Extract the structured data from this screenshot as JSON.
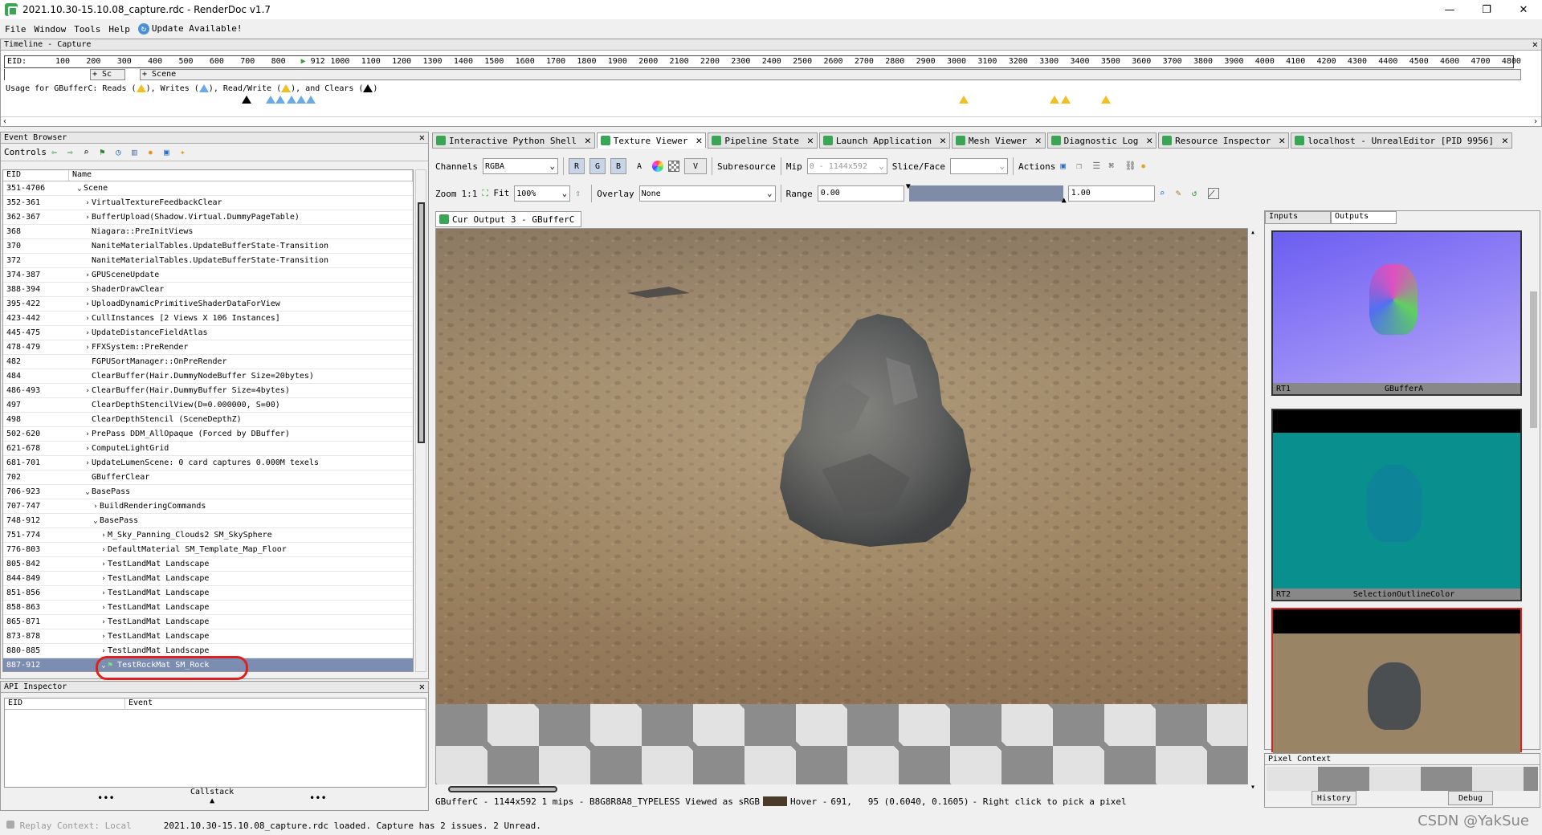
{
  "window": {
    "title": "2021.10.30-15.10.08_capture.rdc - RenderDoc v1.7",
    "minimize": "—",
    "maximize": "❐",
    "close": "✕"
  },
  "menubar": {
    "items": [
      "File",
      "Window",
      "Tools",
      "Help"
    ],
    "update": "Update Available!"
  },
  "timeline": {
    "title": "Timeline - Capture",
    "eid_label": "EID:",
    "ticks": [
      "100",
      "200",
      "300",
      "400",
      "500",
      "600",
      "700",
      "800",
      "912",
      "1000",
      "1100",
      "1200",
      "1300",
      "1400",
      "1500",
      "1600",
      "1700",
      "1800",
      "1900",
      "2000",
      "2100",
      "2200",
      "2300",
      "2400",
      "2500",
      "2600",
      "2700",
      "2800",
      "2900",
      "3000",
      "3100",
      "3200",
      "3300",
      "3400",
      "3500",
      "3600",
      "3700",
      "3800",
      "3900",
      "4000",
      "4100",
      "4200",
      "4300",
      "4400",
      "4500",
      "4600",
      "4700",
      "4800"
    ],
    "sections": [
      "+ Sc",
      "+ Scene"
    ],
    "usage_prefix": "Usage for GBufferC: Reads (",
    "usage_writes": "), Writes (",
    "usage_rw": "), Read/Write (",
    "usage_clears": "), and Clears (",
    "usage_end": ")",
    "colors": {
      "reads": "#f0c020",
      "writes": "#6aaae8",
      "clears": "#000000"
    }
  },
  "event_browser": {
    "title": "Event Browser",
    "controls_label": "Controls",
    "col_eid": "EID",
    "col_name": "Name",
    "rows": [
      {
        "eid": "351-4706",
        "name": "Scene",
        "indent": 0,
        "arrow": "v"
      },
      {
        "eid": "352-361",
        "name": "VirtualTextureFeedbackClear",
        "indent": 1,
        "arrow": ">"
      },
      {
        "eid": "362-367",
        "name": "BufferUpload(Shadow.Virtual.DummyPageTable)",
        "indent": 1,
        "arrow": ">"
      },
      {
        "eid": "368",
        "name": "Niagara::PreInitViews",
        "indent": 1,
        "arrow": ""
      },
      {
        "eid": "370",
        "name": "NaniteMaterialTables.UpdateBufferState-Transition",
        "indent": 1,
        "arrow": ""
      },
      {
        "eid": "372",
        "name": "NaniteMaterialTables.UpdateBufferState-Transition",
        "indent": 1,
        "arrow": ""
      },
      {
        "eid": "374-387",
        "name": "GPUSceneUpdate",
        "indent": 1,
        "arrow": ">"
      },
      {
        "eid": "388-394",
        "name": "ShaderDrawClear",
        "indent": 1,
        "arrow": ">"
      },
      {
        "eid": "395-422",
        "name": "UploadDynamicPrimitiveShaderDataForView",
        "indent": 1,
        "arrow": ">"
      },
      {
        "eid": "423-442",
        "name": "CullInstances [2 Views X 106 Instances]",
        "indent": 1,
        "arrow": ">"
      },
      {
        "eid": "445-475",
        "name": "UpdateDistanceFieldAtlas",
        "indent": 1,
        "arrow": ">"
      },
      {
        "eid": "478-479",
        "name": "FFXSystem::PreRender",
        "indent": 1,
        "arrow": ">"
      },
      {
        "eid": "482",
        "name": "FGPUSortManager::OnPreRender",
        "indent": 1,
        "arrow": ""
      },
      {
        "eid": "484",
        "name": "ClearBuffer(Hair.DummyNodeBuffer Size=20bytes)",
        "indent": 1,
        "arrow": ""
      },
      {
        "eid": "486-493",
        "name": "ClearBuffer(Hair.DummyBuffer Size=4bytes)",
        "indent": 1,
        "arrow": ">"
      },
      {
        "eid": "497",
        "name": "ClearDepthStencilView(D=0.000000, S=00)",
        "indent": 1,
        "arrow": ""
      },
      {
        "eid": "498",
        "name": "ClearDepthStencil (SceneDepthZ)",
        "indent": 1,
        "arrow": ""
      },
      {
        "eid": "502-620",
        "name": "PrePass DDM_AllOpaque (Forced by DBuffer)",
        "indent": 1,
        "arrow": ">"
      },
      {
        "eid": "621-678",
        "name": "ComputeLightGrid",
        "indent": 1,
        "arrow": ">"
      },
      {
        "eid": "681-701",
        "name": "UpdateLumenScene: 0 card captures 0.000M texels",
        "indent": 1,
        "arrow": ">"
      },
      {
        "eid": "702",
        "name": "GBufferClear",
        "indent": 1,
        "arrow": ""
      },
      {
        "eid": "706-923",
        "name": "BasePass",
        "indent": 1,
        "arrow": "v"
      },
      {
        "eid": "707-747",
        "name": "BuildRenderingCommands",
        "indent": 2,
        "arrow": ">"
      },
      {
        "eid": "748-912",
        "name": "BasePass",
        "indent": 2,
        "arrow": "v"
      },
      {
        "eid": "751-774",
        "name": "M_Sky_Panning_Clouds2 SM_SkySphere",
        "indent": 3,
        "arrow": ">"
      },
      {
        "eid": "776-803",
        "name": "DefaultMaterial SM_Template_Map_Floor",
        "indent": 3,
        "arrow": ">"
      },
      {
        "eid": "805-842",
        "name": "TestLandMat Landscape",
        "indent": 3,
        "arrow": ">"
      },
      {
        "eid": "844-849",
        "name": "TestLandMat Landscape",
        "indent": 3,
        "arrow": ">"
      },
      {
        "eid": "851-856",
        "name": "TestLandMat Landscape",
        "indent": 3,
        "arrow": ">"
      },
      {
        "eid": "858-863",
        "name": "TestLandMat Landscape",
        "indent": 3,
        "arrow": ">"
      },
      {
        "eid": "865-871",
        "name": "TestLandMat Landscape",
        "indent": 3,
        "arrow": ">"
      },
      {
        "eid": "873-878",
        "name": "TestLandMat Landscape",
        "indent": 3,
        "arrow": ">"
      },
      {
        "eid": "880-885",
        "name": "TestLandMat Landscape",
        "indent": 3,
        "arrow": ">"
      },
      {
        "eid": "887-912",
        "name": "TestRockMat SM_Rock",
        "indent": 3,
        "arrow": "v",
        "selected": true
      }
    ]
  },
  "api_inspector": {
    "title": "API Inspector",
    "col_eid": "EID",
    "col_event": "Event",
    "callstack": "Callstack",
    "dots": "•••"
  },
  "tabs": [
    {
      "label": "Interactive Python Shell",
      "active": false
    },
    {
      "label": "Texture Viewer",
      "active": true
    },
    {
      "label": "Pipeline State",
      "active": false
    },
    {
      "label": "Launch Application",
      "active": false
    },
    {
      "label": "Mesh Viewer",
      "active": false
    },
    {
      "label": "Diagnostic Log",
      "active": false
    },
    {
      "label": "Resource Inspector",
      "active": false
    },
    {
      "label": "localhost - UnrealEditor [PID 9956]",
      "active": false
    }
  ],
  "texture_viewer": {
    "channels_label": "Channels",
    "channels_value": "RGBA",
    "channel_buttons": [
      "R",
      "G",
      "B",
      "A"
    ],
    "v_button": "V",
    "subresource_label": "Subresource",
    "mip_label": "Mip",
    "mip_value": "0 - 1144x592",
    "slice_label": "Slice/Face",
    "actions_label": "Actions",
    "zoom_label": "Zoom",
    "zoom_ratio": "1:1",
    "fit_label": "Fit",
    "zoom_value": "100%",
    "overlay_label": "Overlay",
    "overlay_value": "None",
    "range_label": "Range",
    "range_min": "0.00",
    "range_max": "1.00",
    "subtab": "Cur Output 3 - GBufferC",
    "status": {
      "resource": "GBufferC - 1144x592 1 mips - B8G8R8A8_TYPELESS Viewed as sRGB",
      "hover": "Hover -",
      "coords": "691,   95 (0.6040, 0.1605)",
      "hint": "- Right click to pick a pixel"
    }
  },
  "thumbnails": {
    "tabs": [
      "Inputs",
      "Outputs"
    ],
    "items": [
      {
        "slot": "RT1",
        "name": "GBufferA"
      },
      {
        "slot": "RT2",
        "name": "SelectionOutlineColor"
      },
      {
        "slot": "",
        "name": ""
      }
    ]
  },
  "pixel_context": {
    "title": "Pixel Context",
    "history": "History",
    "debug": "Debug"
  },
  "statusbar": {
    "replay": "Replay Context: Local",
    "message": "2021.10.30-15.10.08_capture.rdc loaded. Capture has 2 issues. 2 Unread."
  },
  "watermark": "CSDN @YakSue"
}
